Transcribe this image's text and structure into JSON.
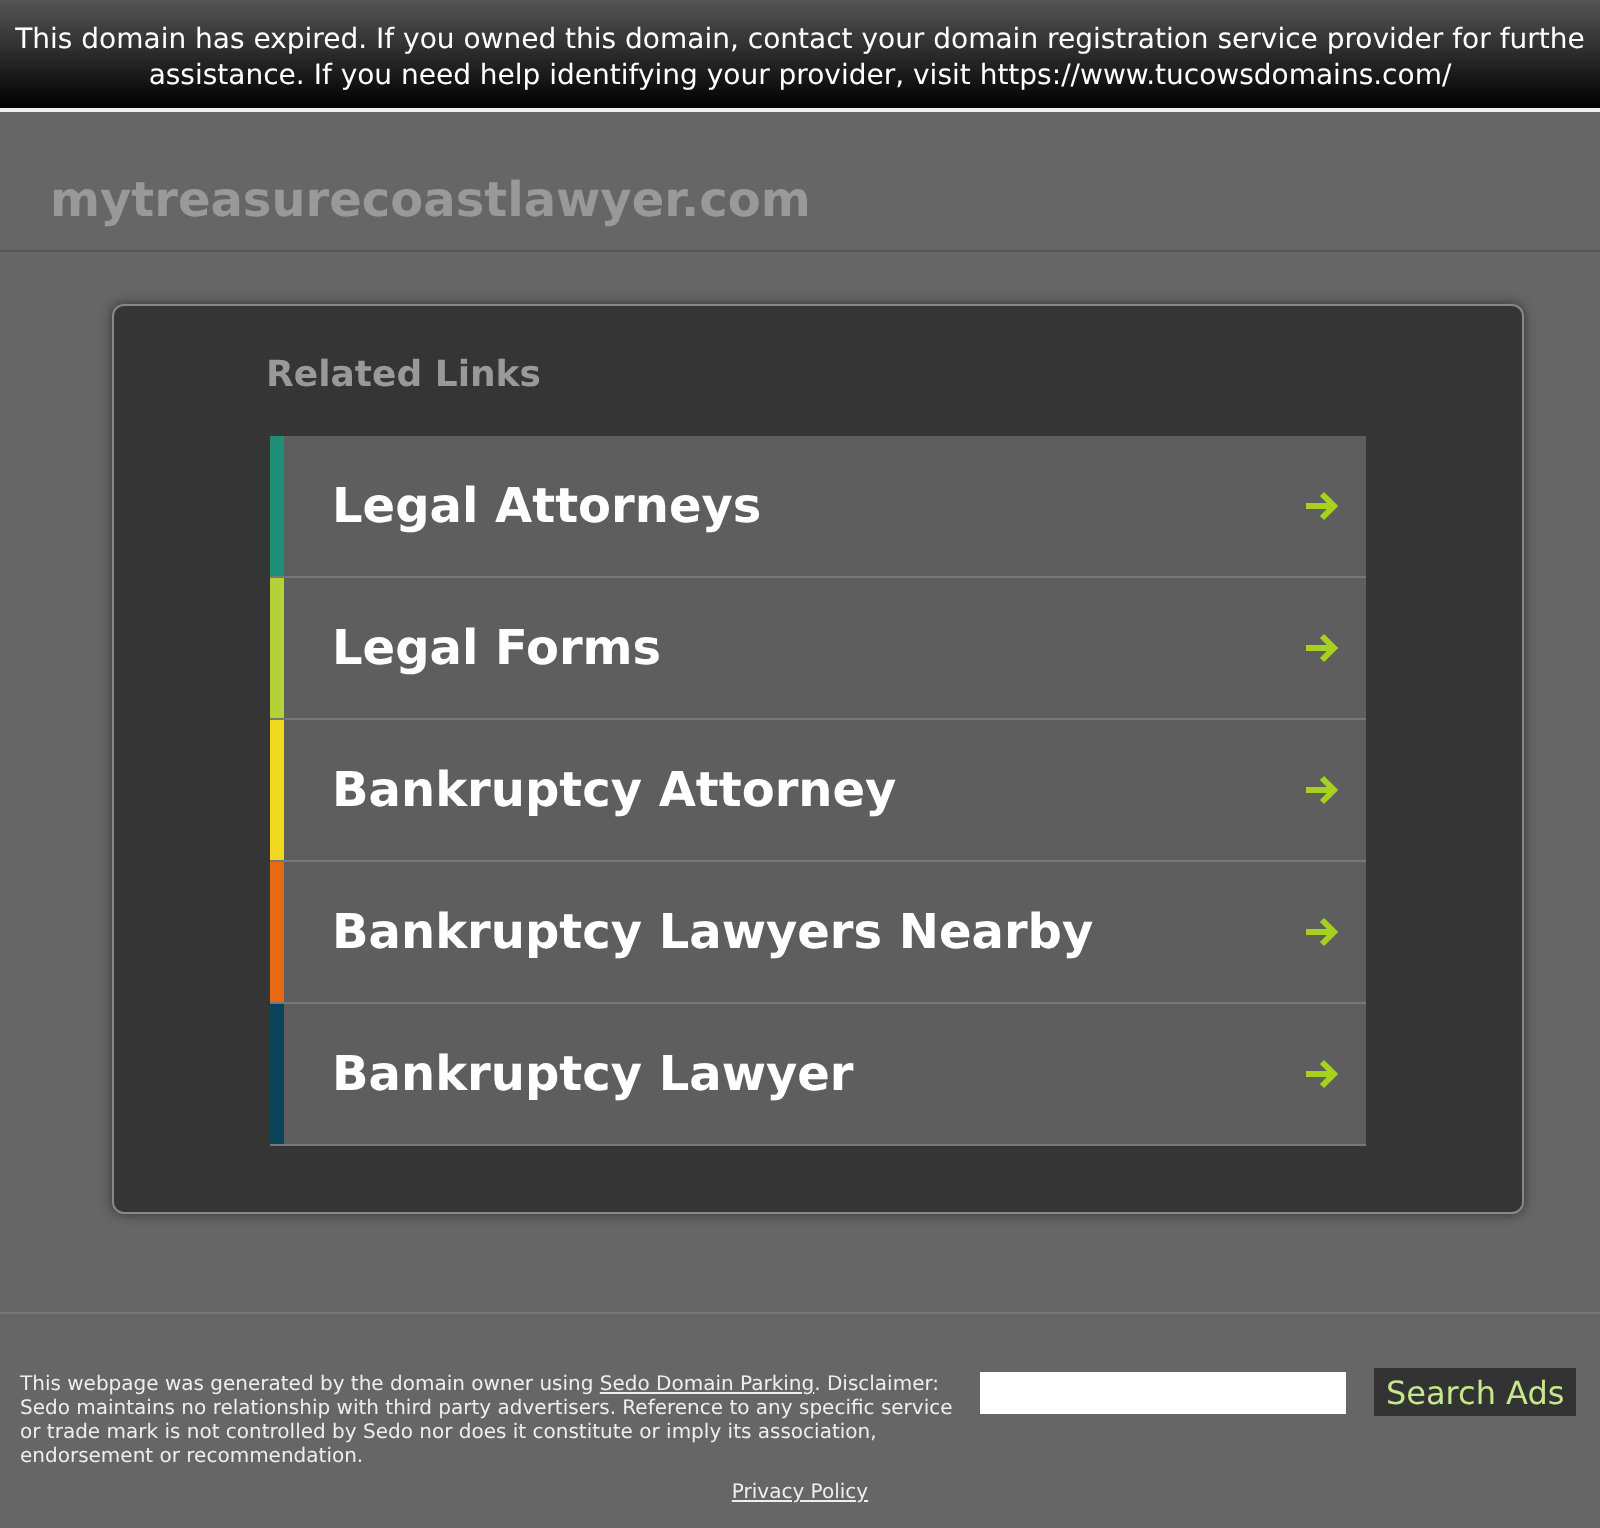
{
  "banner": {
    "lines": [
      "This domain has expired. If you owned this domain, contact your domain registration service provider for furthe",
      "assistance. If you need help identifying your provider, visit https://www.tucowsdomains.com/"
    ]
  },
  "domain": "mytreasurecoastlawyer.com",
  "related": {
    "title": "Related Links",
    "links": [
      {
        "label": "Legal Attorneys",
        "color": "#1e8f76"
      },
      {
        "label": "Legal Forms",
        "color": "#b2d236"
      },
      {
        "label": "Bankruptcy Attorney",
        "color": "#f2d91f"
      },
      {
        "label": "Bankruptcy Lawyers Nearby",
        "color": "#e8690f"
      },
      {
        "label": "Bankruptcy Lawyer",
        "color": "#0b4459"
      }
    ]
  },
  "footer": {
    "disclaimer_before": "This webpage was generated by the domain owner using ",
    "disclaimer_link": "Sedo Domain Parking",
    "disclaimer_after": ". Disclaimer: Sedo maintains no relationship with third party advertisers. Reference to any specific service or trade mark is not controlled by Sedo nor does it constitute or imply its association, endorsement or recommendation.",
    "search_button": "Search Ads",
    "privacy": "Privacy Policy"
  }
}
